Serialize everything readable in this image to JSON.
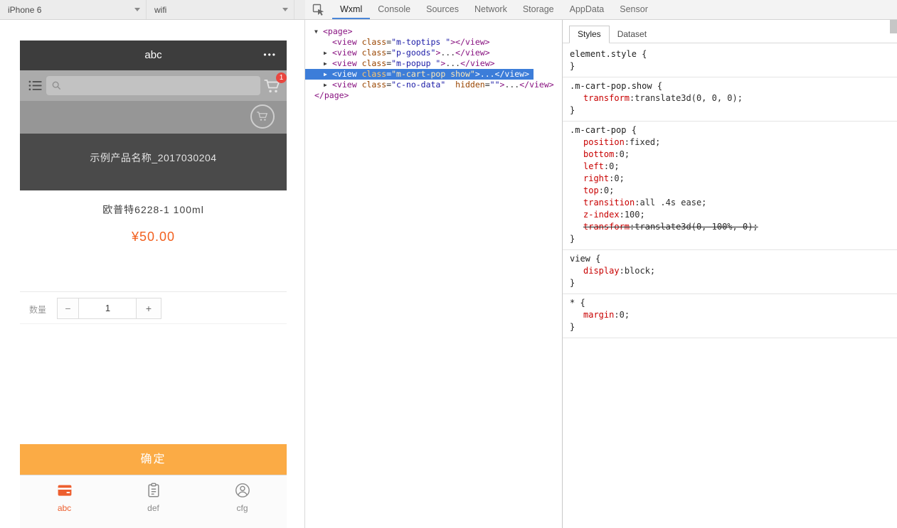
{
  "colors": {
    "accent_orange": "#ed5f2f",
    "price_orange": "#f2601f",
    "confirm_orange": "#fbab45",
    "badge_red": "#e9463f",
    "selection_blue": "#3c7dd9",
    "navbar_dark": "#3d3d3d"
  },
  "simulator": {
    "toolbar": {
      "device": "iPhone 6",
      "network": "wifi"
    },
    "nav": {
      "title": "abc",
      "menu_dots": "•••"
    },
    "search_bar": {
      "menu_icon": "list-icon",
      "input_icon": "magnifier-icon",
      "input_value": "",
      "cart_icon": "cart-icon",
      "cart_badge": "1"
    },
    "goods_page": {
      "float_icon": "cart-icon",
      "banner_title": "示例产品名称_2017030204"
    },
    "cart_popup": {
      "product_name": "欧普特6228-1 100ml",
      "price": "¥50.00",
      "qty_label": "数量",
      "minus_label": "−",
      "qty_value": "1",
      "plus_label": "+",
      "confirm_label": "确定"
    },
    "tabbar": {
      "items": [
        {
          "label": "abc",
          "icon": "wallet-icon",
          "active": true
        },
        {
          "label": "def",
          "icon": "clipboard-icon",
          "active": false
        },
        {
          "label": "cfg",
          "icon": "user-icon",
          "active": false
        }
      ]
    }
  },
  "devtools": {
    "inspect_icon": "inspect-element-icon",
    "tabs": [
      {
        "label": "Wxml",
        "active": true
      },
      {
        "label": "Console",
        "active": false
      },
      {
        "label": "Sources",
        "active": false
      },
      {
        "label": "Network",
        "active": false
      },
      {
        "label": "Storage",
        "active": false
      },
      {
        "label": "AppData",
        "active": false
      },
      {
        "label": "Sensor",
        "active": false
      }
    ],
    "wxml_tree": {
      "lines": [
        {
          "level": 0,
          "arrow": "expanded",
          "selected": false,
          "tokens": [
            {
              "c": "tag",
              "v": "<page>"
            }
          ]
        },
        {
          "level": 1,
          "arrow": "none",
          "selected": false,
          "tokens": [
            {
              "c": "tag",
              "v": "<view"
            },
            {
              "c": "plain",
              "v": " "
            },
            {
              "c": "attr",
              "v": "class"
            },
            {
              "c": "plain",
              "v": "="
            },
            {
              "c": "val",
              "v": "\"m-toptips \""
            },
            {
              "c": "tag",
              "v": "></view>"
            }
          ]
        },
        {
          "level": 1,
          "arrow": "collapsed",
          "selected": false,
          "tokens": [
            {
              "c": "tag",
              "v": "<view"
            },
            {
              "c": "plain",
              "v": " "
            },
            {
              "c": "attr",
              "v": "class"
            },
            {
              "c": "plain",
              "v": "="
            },
            {
              "c": "val",
              "v": "\"p-goods\""
            },
            {
              "c": "tag",
              "v": ">"
            },
            {
              "c": "plain",
              "v": "..."
            },
            {
              "c": "tag",
              "v": "</view>"
            }
          ]
        },
        {
          "level": 1,
          "arrow": "collapsed",
          "selected": false,
          "tokens": [
            {
              "c": "tag",
              "v": "<view"
            },
            {
              "c": "plain",
              "v": " "
            },
            {
              "c": "attr",
              "v": "class"
            },
            {
              "c": "plain",
              "v": "="
            },
            {
              "c": "val",
              "v": "\"m-popup \""
            },
            {
              "c": "tag",
              "v": ">"
            },
            {
              "c": "plain",
              "v": "..."
            },
            {
              "c": "tag",
              "v": "</view>"
            }
          ]
        },
        {
          "level": 1,
          "arrow": "collapsed",
          "selected": true,
          "tokens": [
            {
              "c": "tag",
              "v": "<view"
            },
            {
              "c": "plain",
              "v": " "
            },
            {
              "c": "attr",
              "v": "class"
            },
            {
              "c": "plain",
              "v": "="
            },
            {
              "c": "val",
              "v": "\"m-cart-pop show\""
            },
            {
              "c": "tag",
              "v": ">"
            },
            {
              "c": "plain",
              "v": "..."
            },
            {
              "c": "tag",
              "v": "</view>"
            }
          ]
        },
        {
          "level": 1,
          "arrow": "collapsed",
          "selected": false,
          "tokens": [
            {
              "c": "tag",
              "v": "<view"
            },
            {
              "c": "plain",
              "v": " "
            },
            {
              "c": "attr",
              "v": "class"
            },
            {
              "c": "plain",
              "v": "="
            },
            {
              "c": "val",
              "v": "\"c-no-data\""
            },
            {
              "c": "plain",
              "v": "  "
            },
            {
              "c": "attr",
              "v": "hidden"
            },
            {
              "c": "plain",
              "v": "="
            },
            {
              "c": "val",
              "v": "\"\""
            },
            {
              "c": "tag",
              "v": ">"
            },
            {
              "c": "plain",
              "v": "..."
            },
            {
              "c": "tag",
              "v": "</view>"
            }
          ]
        },
        {
          "level": 0,
          "arrow": "close",
          "selected": false,
          "tokens": [
            {
              "c": "tag",
              "v": "</page>"
            }
          ]
        }
      ]
    },
    "styles_panel": {
      "tabs": [
        {
          "label": "Styles",
          "active": true
        },
        {
          "label": "Dataset",
          "active": false
        }
      ],
      "rules": [
        {
          "selector": "element.style",
          "props": []
        },
        {
          "selector": ".m-cart-pop.show",
          "props": [
            {
              "name": "transform",
              "value": "translate3d(0, 0, 0);",
              "struck": false
            }
          ]
        },
        {
          "selector": ".m-cart-pop",
          "props": [
            {
              "name": "position",
              "value": "fixed;",
              "struck": false
            },
            {
              "name": "bottom",
              "value": "0;",
              "struck": false
            },
            {
              "name": "left",
              "value": "0;",
              "struck": false
            },
            {
              "name": "right",
              "value": "0;",
              "struck": false
            },
            {
              "name": "top",
              "value": "0;",
              "struck": false
            },
            {
              "name": "transition",
              "value": "all .4s ease;",
              "struck": false
            },
            {
              "name": "z-index",
              "value": "100;",
              "struck": false
            },
            {
              "name": "transform",
              "value": "translate3d(0, 100%, 0);",
              "struck": true
            }
          ]
        },
        {
          "selector": "view",
          "props": [
            {
              "name": "display",
              "value": "block;",
              "struck": false
            }
          ]
        },
        {
          "selector": "*",
          "props": [
            {
              "name": "margin",
              "value": "0;",
              "struck": false
            }
          ]
        }
      ]
    }
  }
}
